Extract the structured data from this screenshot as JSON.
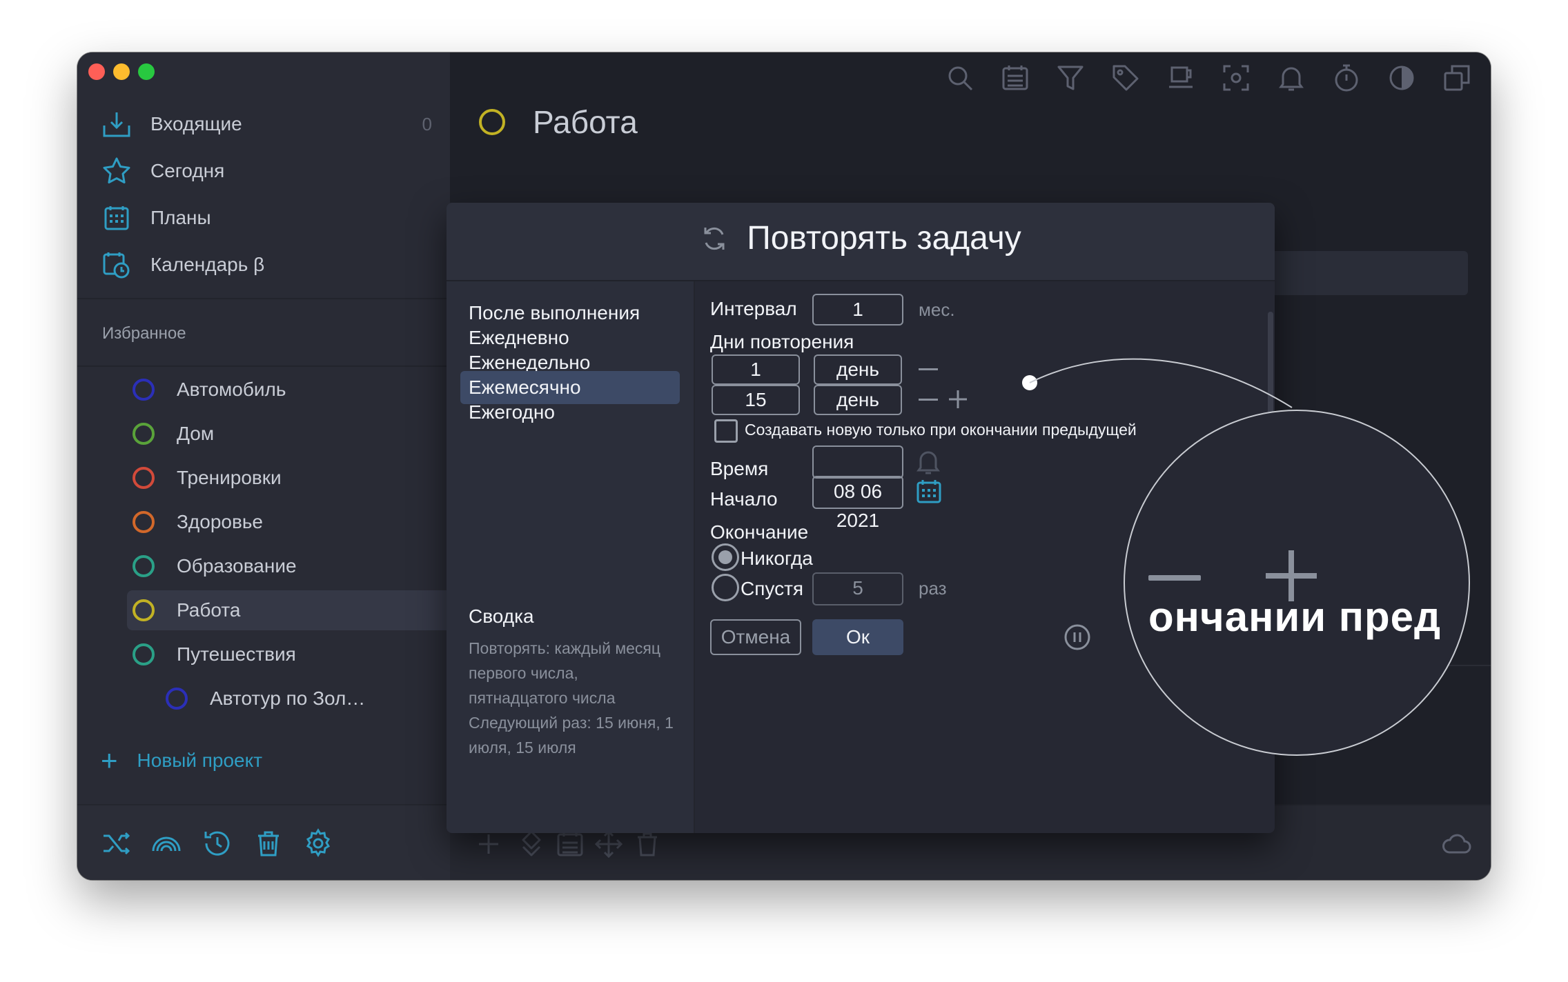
{
  "sidebar": {
    "nav": [
      {
        "label": "Входящие",
        "count": "0",
        "icon": "inbox-icon"
      },
      {
        "label": "Сегодня",
        "icon": "star-icon"
      },
      {
        "label": "Планы",
        "icon": "calendar-grid-icon"
      },
      {
        "label": "Календарь β",
        "icon": "calendar-clock-icon"
      }
    ],
    "favorites_title": "Избранное",
    "projects": [
      {
        "label": "Автомобиль",
        "color": "#2b2fb8"
      },
      {
        "label": "Дом",
        "color": "#5aa33a"
      },
      {
        "label": "Тренировки",
        "color": "#d24a3a"
      },
      {
        "label": "Здоровье",
        "color": "#d2682a"
      },
      {
        "label": "Образование",
        "color": "#2aa087"
      },
      {
        "label": "Работа",
        "color": "#c2b224"
      },
      {
        "label": "Путешествия",
        "color": "#2aa087"
      },
      {
        "label": "Автотур по Зол…",
        "color": "#2b2fb8"
      }
    ],
    "new_project": "Новый проект"
  },
  "main": {
    "title": "Работа",
    "title_color": "#c2b224"
  },
  "dialog": {
    "title": "Повторять задачу",
    "frequencies": [
      "После выполнения",
      "Ежедневно",
      "Еженедельно",
      "Ежемесячно",
      "Ежегодно"
    ],
    "selected_frequency": "Ежемесячно",
    "summary_title": "Сводка",
    "summary_text": "Повторять: каждый месяц первого числа, пятнадцатого числа",
    "next_text": "Следующий раз: 15 июня, 1 июля, 15 июля",
    "interval_label": "Интервал",
    "interval_value": "1",
    "interval_unit": "мес.",
    "days_label": "Дни повторения",
    "day_rows": [
      {
        "value": "1",
        "unit": "день"
      },
      {
        "value": "15",
        "unit": "день"
      }
    ],
    "checkbox_label": "Создавать новую только при окончании предыдущей",
    "time_label": "Время",
    "time_value": "",
    "start_label": "Начало",
    "start_value": "08 06 2021",
    "end_label": "Окончание",
    "end_never": "Никогда",
    "end_after": "Спустя",
    "end_after_value": "5",
    "end_after_unit": "раз",
    "cancel_label": "Отмена",
    "ok_label": "Ок",
    "accent": "#2f9ec4"
  },
  "magnifier": {
    "text": "ончании пред"
  }
}
